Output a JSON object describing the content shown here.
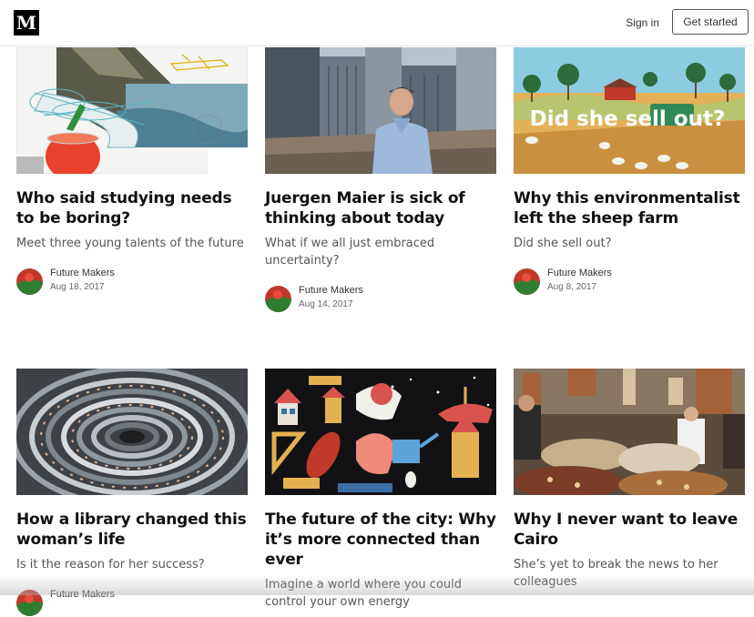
{
  "header": {
    "logo_letter": "M",
    "signin_label": "Sign in",
    "get_started_label": "Get started"
  },
  "posts": [
    {
      "title": "Who said studying needs to be boring?",
      "subtitle": "Meet three young talents of the future",
      "author": "Future Makers",
      "date": "Aug 18, 2017"
    },
    {
      "title": "Juergen Maier is sick of thinking about today",
      "subtitle": "What if we all just embraced uncertainty?",
      "author": "Future Makers",
      "date": "Aug 14, 2017"
    },
    {
      "title": "Why this environmentalist left the sheep farm",
      "subtitle": "Did she sell out?",
      "author": "Future Makers",
      "date": "Aug 8, 2017",
      "image_caption": "Did she sell out?"
    },
    {
      "title": "How a library changed this woman’s life",
      "subtitle": "Is it the reason for her success?",
      "author": "Future Makers",
      "date": ""
    },
    {
      "title": "The future of the city: Why it’s more connected than ever",
      "subtitle": "Imagine a world where you could control your own energy",
      "author": "",
      "date": ""
    },
    {
      "title": "Why I never want to leave Cairo",
      "subtitle": "She’s yet to break the news to her colleagues",
      "author": "",
      "date": ""
    }
  ],
  "colors": {
    "avatar_top": "#c0392b",
    "avatar_bottom": "#2e7d32"
  }
}
